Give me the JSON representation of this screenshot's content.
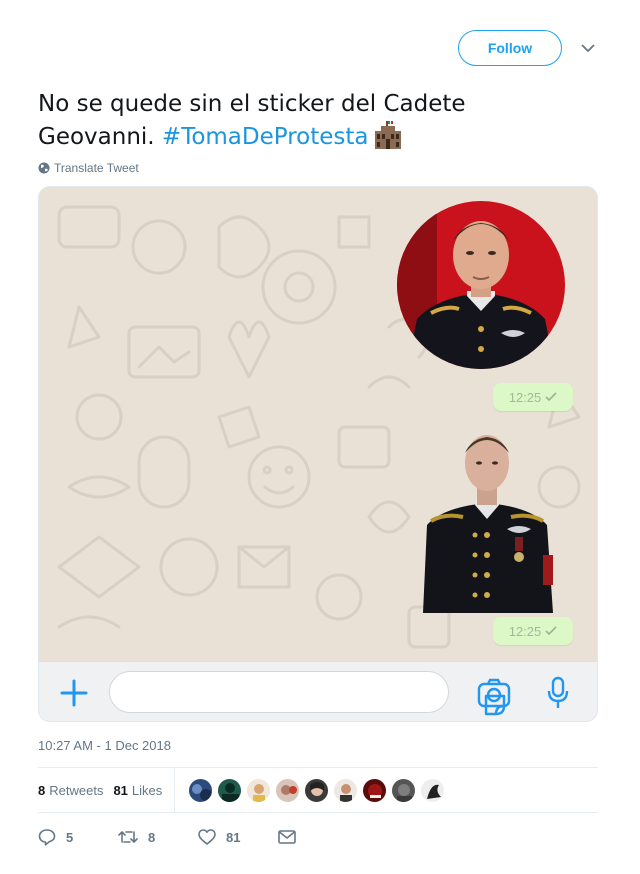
{
  "header": {
    "follow_label": "Follow"
  },
  "tweet": {
    "text": "No se quede sin el sticker del Cadete Geovanni.",
    "hashtag": "#TomaDeProtesta",
    "translate_label": "Translate Tweet",
    "timestamp": "10:27 AM - 1 Dec 2018"
  },
  "whatsapp": {
    "messages": [
      {
        "time": "12:25",
        "status_icon": "check-icon"
      },
      {
        "time": "12:25",
        "status_icon": "check-icon"
      }
    ],
    "icons": [
      "plus-icon",
      "sticker-icon",
      "camera-icon",
      "microphone-icon"
    ],
    "colors": {
      "chat_bg": "#e9e1d6",
      "bubble": "#dcf8c6",
      "accent": "#2196f3"
    }
  },
  "stats": {
    "retweets_count": "8",
    "retweets_label": "Retweets",
    "likes_count": "81",
    "likes_label": "Likes"
  },
  "actions": {
    "reply_count": "5",
    "retweet_count": "8",
    "like_count": "81"
  },
  "colors": {
    "brand": "#1da1f2",
    "hashtag": "#1b95e0",
    "muted": "#657786"
  }
}
